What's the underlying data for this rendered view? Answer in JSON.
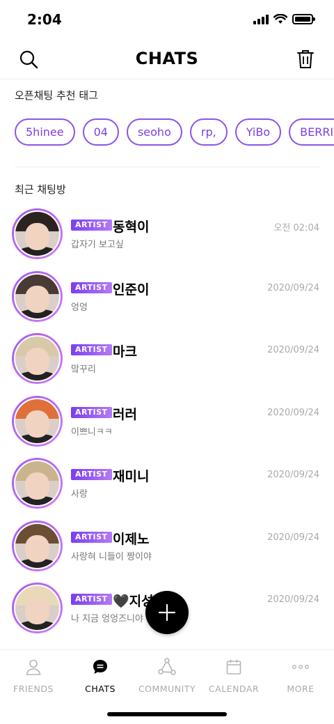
{
  "status_bar": {
    "time": "2:04"
  },
  "header": {
    "title": "CHATS",
    "search_icon": "search-icon",
    "trash_icon": "trash-icon"
  },
  "tags": {
    "title": "오픈채팅 추천 태그",
    "items": [
      "5hinee",
      "04",
      "seoho",
      "rp,",
      "YiBo",
      "BERRIE"
    ]
  },
  "recent": {
    "title": "최근 채팅방",
    "badge": "ARTIST",
    "chats": [
      {
        "name": "동혁이",
        "preview": "갑자기 보고싶",
        "date": "오전 02:04",
        "hair": "#2a2320"
      },
      {
        "name": "인준이",
        "preview": "엉엉",
        "date": "2020/09/24",
        "hair": "#4a3a34"
      },
      {
        "name": "마크",
        "preview": "맠꾸리",
        "date": "2020/09/24",
        "hair": "#d8c9a8"
      },
      {
        "name": "러러",
        "preview": "이쁘니ㅋㅋ",
        "date": "2020/09/24",
        "hair": "#e0703a"
      },
      {
        "name": "재미니",
        "preview": "사랑",
        "date": "2020/09/24",
        "hair": "#c9b48e"
      },
      {
        "name": "이제노",
        "preview": "사랑혀 니들이 짱이야",
        "date": "2020/09/24",
        "hair": "#6b4e34"
      },
      {
        "name": "🖤지성",
        "preview": "나 지금 엉엉즈니야",
        "date": "2020/09/24",
        "hair": "#e8d9b8"
      }
    ]
  },
  "fab": {
    "icon": "plus-icon"
  },
  "tab_bar": {
    "tabs": [
      {
        "label": "FRIENDS",
        "icon": "person-icon",
        "active": false
      },
      {
        "label": "CHATS",
        "icon": "chat-bubble-icon",
        "active": true
      },
      {
        "label": "COMMUNITY",
        "icon": "share-network-icon",
        "active": false
      },
      {
        "label": "CALENDAR",
        "icon": "calendar-icon",
        "active": false
      },
      {
        "label": "MORE",
        "icon": "more-dots-icon",
        "active": false
      }
    ]
  },
  "colors": {
    "accent": "#7b3fe4",
    "badge_start": "#7a3ff0",
    "badge_end": "#b47af6"
  }
}
